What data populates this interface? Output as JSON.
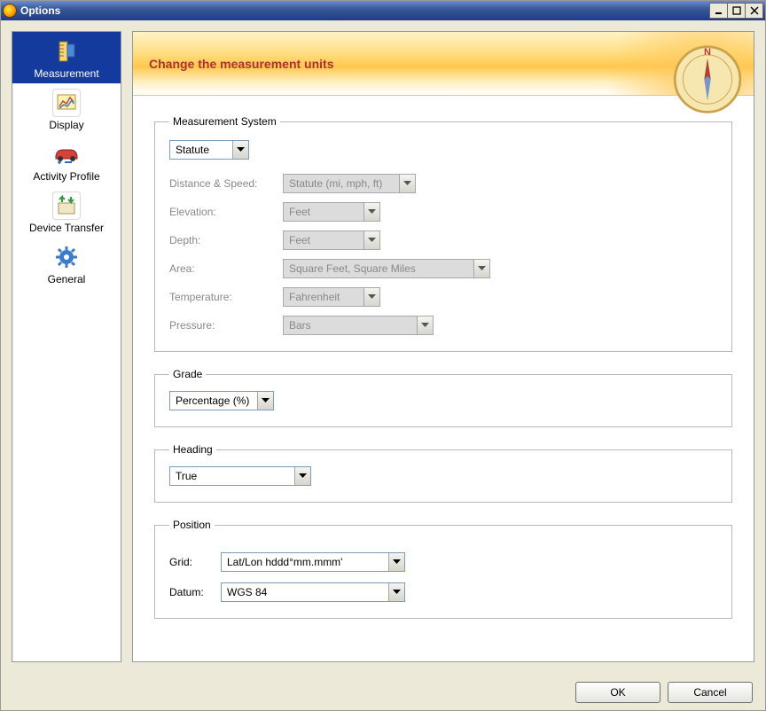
{
  "window": {
    "title": "Options"
  },
  "sidebar": {
    "items": [
      {
        "label": "Measurement"
      },
      {
        "label": "Display"
      },
      {
        "label": "Activity Profile"
      },
      {
        "label": "Device Transfer"
      },
      {
        "label": "General"
      }
    ]
  },
  "banner": {
    "title": "Change the measurement units"
  },
  "measurement_system": {
    "legend": "Measurement System",
    "mode": "Statute",
    "labels": {
      "distance_speed": "Distance & Speed:",
      "elevation": "Elevation:",
      "depth": "Depth:",
      "area": "Area:",
      "temperature": "Temperature:",
      "pressure": "Pressure:"
    },
    "values": {
      "distance_speed": "Statute (mi, mph, ft)",
      "elevation": "Feet",
      "depth": "Feet",
      "area": "Square Feet, Square Miles",
      "temperature": "Fahrenheit",
      "pressure": "Bars"
    }
  },
  "grade": {
    "legend": "Grade",
    "value": "Percentage (%)"
  },
  "heading": {
    "legend": "Heading",
    "value": "True"
  },
  "position": {
    "legend": "Position",
    "grid_label": "Grid:",
    "grid_value": "Lat/Lon hddd°mm.mmm'",
    "datum_label": "Datum:",
    "datum_value": "WGS 84"
  },
  "buttons": {
    "ok": "OK",
    "cancel": "Cancel"
  }
}
